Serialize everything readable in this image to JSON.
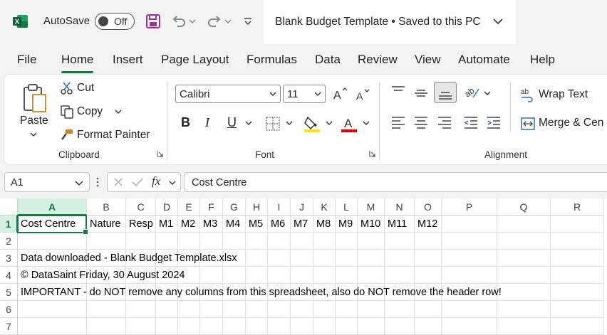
{
  "titlebar": {
    "autosave_label": "AutoSave",
    "autosave_state": "Off",
    "document_title": "Blank Budget Template • Saved to this PC"
  },
  "tabs": [
    "File",
    "Home",
    "Insert",
    "Page Layout",
    "Formulas",
    "Data",
    "Review",
    "View",
    "Automate",
    "Help"
  ],
  "active_tab": "Home",
  "ribbon": {
    "clipboard": {
      "paste": "Paste",
      "cut": "Cut",
      "copy": "Copy",
      "format_painter": "Format Painter",
      "group_label": "Clipboard"
    },
    "font": {
      "font_name": "Calibri",
      "font_size": "11",
      "bold": "B",
      "italic": "I",
      "underline": "U",
      "group_label": "Font"
    },
    "alignment": {
      "wrap_text": "Wrap Text",
      "merge_center": "Merge & Cen",
      "group_label": "Alignment"
    }
  },
  "formula_bar": {
    "name_box": "A1",
    "fx": "fx",
    "value": "Cost Centre"
  },
  "grid": {
    "columns": [
      "A",
      "B",
      "C",
      "D",
      "E",
      "F",
      "G",
      "H",
      "I",
      "J",
      "K",
      "L",
      "M",
      "N",
      "O",
      "P",
      "Q",
      "R"
    ],
    "rows": [
      "1",
      "2",
      "3",
      "4",
      "5",
      "6",
      "7"
    ],
    "row1": [
      "Cost Centre",
      "Nature",
      "Resp",
      "M1",
      "M2",
      "M3",
      "M4",
      "M5",
      "M6",
      "M7",
      "M8",
      "M9",
      "M10",
      "M11",
      "M12"
    ],
    "row3": "Data downloaded - Blank Budget Template.xlsx",
    "row4": "© DataSaint Friday, 30 August 2024",
    "row5": "IMPORTANT - do NOT remove any columns from this spreadsheet, also do NOT remove the header row!"
  },
  "colors": {
    "accent_green": "#107c41",
    "excel_logo": "#107c41",
    "save_icon": "#a0338c",
    "font_color_red": "#e00000",
    "highlight_yellow": "#ffe600"
  }
}
